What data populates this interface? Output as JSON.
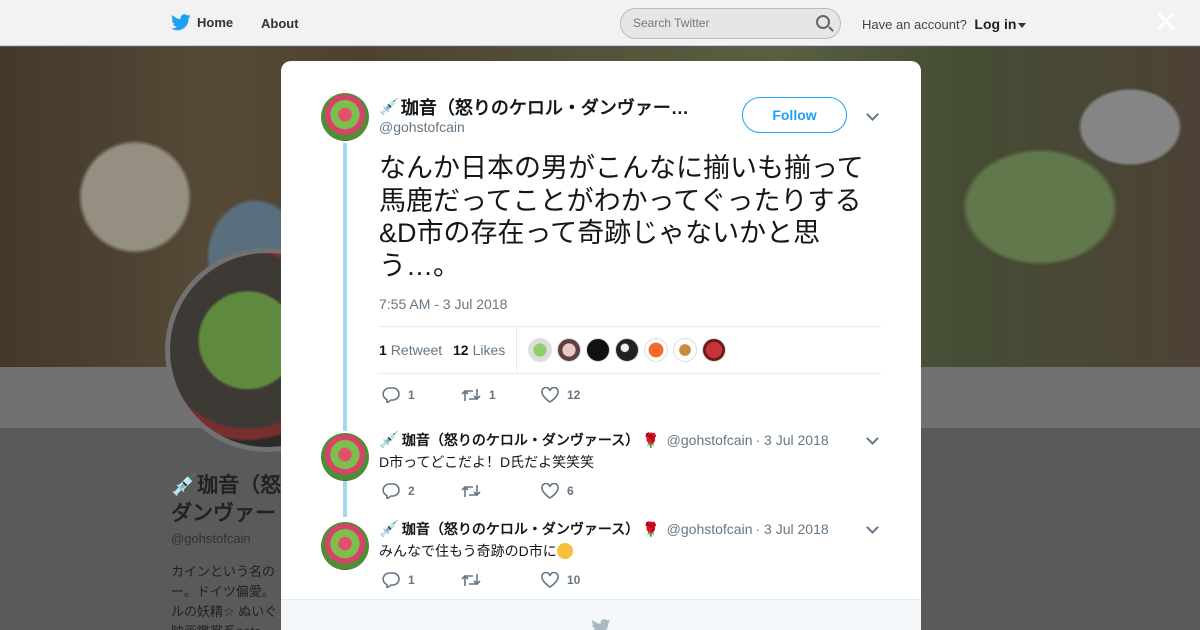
{
  "topbar": {
    "home_label": "Home",
    "about_label": "About",
    "search_placeholder": "Search Twitter",
    "account_prompt": "Have an account?",
    "login_label": "Log in",
    "close_glyph": "✕"
  },
  "background_profile": {
    "name_line1": "珈音（怒",
    "name_line2": "ダンヴァー",
    "handle": "@gohstofcain",
    "bio": "カインという名の\nー。ドイツ偏愛。\nルの妖精☆ ぬいぐ\n映画鑑賞系note"
  },
  "main_tweet": {
    "display_name": "珈音（怒りのケロル・ダンヴァー…",
    "handle": "@gohstofcain",
    "follow_label": "Follow",
    "text": "なんか日本の男がこんなに揃いも揃って馬鹿だってことがわかってぐったりする&D市の存在って奇跡じゃないかと思う…。",
    "timestamp": "7:55 AM - 3 Jul 2018",
    "retweets_count": "1",
    "retweets_label": "Retweet",
    "likes_count": "12",
    "likes_label": "Likes",
    "actions": {
      "replies": "1",
      "retweets": "1",
      "likes": "12"
    }
  },
  "replies": [
    {
      "display_name": "珈音（怒りのケロル・ダンヴァース）",
      "handle": "@gohstofcain",
      "date": "· 3 Jul 2018",
      "text": "D市ってどこだよ！D氏だよ笑笑笑",
      "actions": {
        "replies": "2",
        "retweets": "",
        "likes": "6"
      }
    },
    {
      "display_name": "珈音（怒りのケロル・ダンヴァース）",
      "handle": "@gohstofcain",
      "date": "· 3 Jul 2018",
      "text": "みんなで住もう奇跡のD市に",
      "actions": {
        "replies": "1",
        "retweets": "",
        "likes": "10"
      }
    }
  ],
  "colors": {
    "accent": "#1da1f2",
    "thread_line": "#a4d9ed",
    "secondary_text": "#657786"
  },
  "icons": [
    "twitter-bird-icon",
    "search-icon",
    "close-icon",
    "reply-icon",
    "retweet-icon",
    "like-icon",
    "chevron-down-icon",
    "syringe-emoji-icon",
    "rose-emoji-icon",
    "rofl-emoji-icon"
  ]
}
